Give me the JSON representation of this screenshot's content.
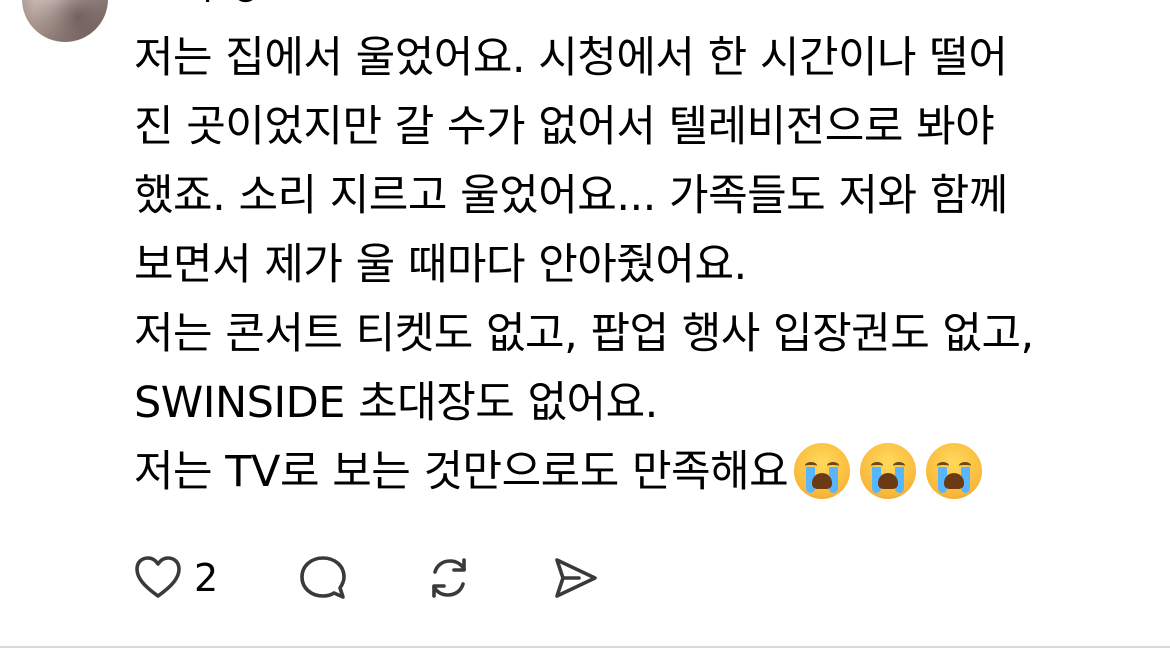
{
  "author": {
    "name_partial": "ㅡ ㄱ  ㅇ"
  },
  "post": {
    "paragraphs": [
      "저는 집에서 울었어요. 시청에서 한 시간이나 떨어\n진 곳이었지만 갈 수가 없어서 텔레비전으로 봐야\n했죠. 소리 지르고 울었어요... 가족들도 저와 함께\n보면서 제가 울 때마다 안아줬어요.",
      "저는 콘서트 티켓도 없고, 팝업 행사 입장권도 없고,\nSWINSIDE 초대장도 없어요.",
      "저는 TV로 보는 것만으로도 만족해요"
    ],
    "emojis": [
      "loudly-crying-face",
      "loudly-crying-face",
      "loudly-crying-face"
    ]
  },
  "actions": {
    "like_count": "2",
    "icons": {
      "like": "heart-icon",
      "comment": "comment-icon",
      "repost": "repost-icon",
      "share": "share-icon"
    }
  },
  "colors": {
    "text": "#000000",
    "icon": "#3a3a3a",
    "background": "#ffffff",
    "divider": "#d9d9d9"
  }
}
